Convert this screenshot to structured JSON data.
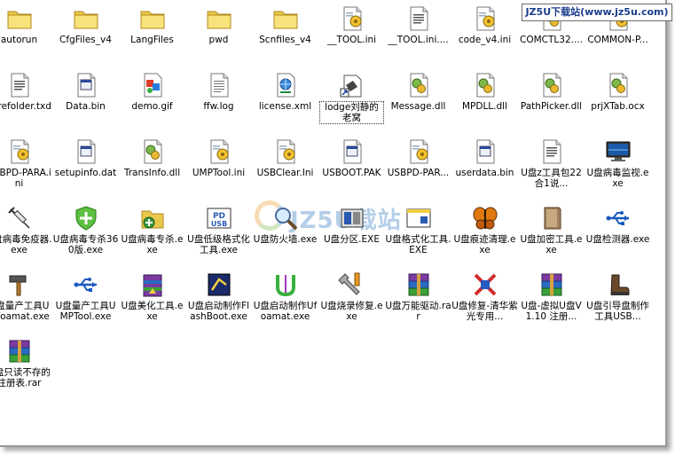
{
  "site_badge": "JZ5U下载站(www.jz5u.com)",
  "watermark": "JZ5U载站",
  "files": [
    {
      "label": "autorun",
      "icon": "folder-icon"
    },
    {
      "label": "CfgFiles_v4",
      "icon": "folder-icon"
    },
    {
      "label": "LangFiles",
      "icon": "folder-icon"
    },
    {
      "label": "pwd",
      "icon": "folder-icon"
    },
    {
      "label": "Scnfiles_v4",
      "icon": "folder-icon"
    },
    {
      "label": "__TOOL.ini",
      "icon": "ini-icon"
    },
    {
      "label": "__TOOL.ini....",
      "icon": "text-doc-icon"
    },
    {
      "label": "code_v4.ini",
      "icon": "ini-icon"
    },
    {
      "label": "COMCTL32....",
      "icon": "dll-icon"
    },
    {
      "label": "COMMON-P...",
      "icon": "ini-icon"
    },
    {
      "label": "curefolder.txd",
      "icon": "text-doc-icon"
    },
    {
      "label": "Data.bin",
      "icon": "bin-icon"
    },
    {
      "label": "demo.gif",
      "icon": "image-icon"
    },
    {
      "label": "ffw.log",
      "icon": "log-icon"
    },
    {
      "label": "license.xml",
      "icon": "xml-icon"
    },
    {
      "label": "lodge刘静的老窝",
      "icon": "shortcut-icon"
    },
    {
      "label": "Message.dll",
      "icon": "dll-icon"
    },
    {
      "label": "MPDLL.dll",
      "icon": "dll-icon"
    },
    {
      "label": "PathPicker.dll",
      "icon": "dll-icon"
    },
    {
      "label": "prjXTab.ocx",
      "icon": "dll-icon"
    },
    {
      "label": "USBPD-PARA.ini",
      "icon": "ini-icon"
    },
    {
      "label": "setupinfo.dat",
      "icon": "bin-icon"
    },
    {
      "label": "TransInfo.dll",
      "icon": "dll-icon"
    },
    {
      "label": "UMPTool.ini",
      "icon": "ini-icon"
    },
    {
      "label": "USBClear.Ini",
      "icon": "ini-icon"
    },
    {
      "label": "USBOOT.PAK",
      "icon": "bin-icon"
    },
    {
      "label": "USBPD-PAR...",
      "icon": "ini-icon"
    },
    {
      "label": "userdata.bin",
      "icon": "bin-icon"
    },
    {
      "label": "U盘z工具包22合1说...",
      "icon": "text-doc-icon"
    },
    {
      "label": "U盘病毒监视.exe",
      "icon": "monitor-icon"
    },
    {
      "label": "U盘病毒免疫器.exe",
      "icon": "syringe-icon"
    },
    {
      "label": "U盘病毒专杀360版.exe",
      "icon": "shield-icon"
    },
    {
      "label": "U盘病毒专杀.exe",
      "icon": "folder-plus-icon"
    },
    {
      "label": "U盘低级格式化工具.exe",
      "icon": "usb-pd-icon"
    },
    {
      "label": "U盘防火墙.exe",
      "icon": "magnifier-icon"
    },
    {
      "label": "U盘分区.EXE",
      "icon": "partition-icon"
    },
    {
      "label": "U盘格式化工具.EXE",
      "icon": "window-icon"
    },
    {
      "label": "U盘痕迹清理.exe",
      "icon": "butterfly-icon"
    },
    {
      "label": "U盘加密工具.exe",
      "icon": "notebook-icon"
    },
    {
      "label": "U盘检测器.exe",
      "icon": "usb-symbol-icon"
    },
    {
      "label": "U盘量产工具UMfoamat.exe",
      "icon": "hammer-icon"
    },
    {
      "label": "U盘量产工具UMPTool.exe",
      "icon": "usb-symbol-icon"
    },
    {
      "label": "U盘美化工具.exe",
      "icon": "winrar-box-icon"
    },
    {
      "label": "U盘启动制作FlashBoot.exe",
      "icon": "flashboot-icon"
    },
    {
      "label": "U盘启动制作Ufoamat.exe",
      "icon": "uformat-icon"
    },
    {
      "label": "U盘烧录修复.exe",
      "icon": "tools-icon"
    },
    {
      "label": "U盘万能驱动.rar",
      "icon": "rar-icon"
    },
    {
      "label": "U盘修复-清华紫光专用...",
      "icon": "repair-icon"
    },
    {
      "label": "U盘-虚拟U盘V1.10 注册...",
      "icon": "rar-icon"
    },
    {
      "label": "U盘引导盘制作工具USB...",
      "icon": "boot-icon"
    },
    {
      "label": "U盘只读不存的注册表.rar",
      "icon": "rar-icon"
    }
  ],
  "selected_index": 15
}
